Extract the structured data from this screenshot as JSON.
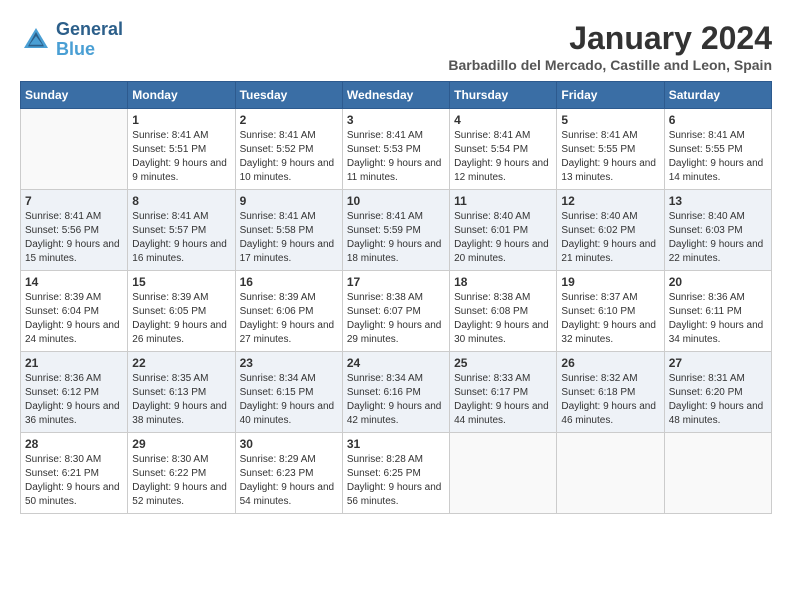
{
  "logo": {
    "text_general": "General",
    "text_blue": "Blue"
  },
  "title": "January 2024",
  "location": "Barbadillo del Mercado, Castille and Leon, Spain",
  "days_of_week": [
    "Sunday",
    "Monday",
    "Tuesday",
    "Wednesday",
    "Thursday",
    "Friday",
    "Saturday"
  ],
  "weeks": [
    [
      {
        "day": "",
        "sunrise": "",
        "sunset": "",
        "daylight": ""
      },
      {
        "day": "1",
        "sunrise": "Sunrise: 8:41 AM",
        "sunset": "Sunset: 5:51 PM",
        "daylight": "Daylight: 9 hours and 9 minutes."
      },
      {
        "day": "2",
        "sunrise": "Sunrise: 8:41 AM",
        "sunset": "Sunset: 5:52 PM",
        "daylight": "Daylight: 9 hours and 10 minutes."
      },
      {
        "day": "3",
        "sunrise": "Sunrise: 8:41 AM",
        "sunset": "Sunset: 5:53 PM",
        "daylight": "Daylight: 9 hours and 11 minutes."
      },
      {
        "day": "4",
        "sunrise": "Sunrise: 8:41 AM",
        "sunset": "Sunset: 5:54 PM",
        "daylight": "Daylight: 9 hours and 12 minutes."
      },
      {
        "day": "5",
        "sunrise": "Sunrise: 8:41 AM",
        "sunset": "Sunset: 5:55 PM",
        "daylight": "Daylight: 9 hours and 13 minutes."
      },
      {
        "day": "6",
        "sunrise": "Sunrise: 8:41 AM",
        "sunset": "Sunset: 5:55 PM",
        "daylight": "Daylight: 9 hours and 14 minutes."
      }
    ],
    [
      {
        "day": "7",
        "sunrise": "Sunrise: 8:41 AM",
        "sunset": "Sunset: 5:56 PM",
        "daylight": "Daylight: 9 hours and 15 minutes."
      },
      {
        "day": "8",
        "sunrise": "Sunrise: 8:41 AM",
        "sunset": "Sunset: 5:57 PM",
        "daylight": "Daylight: 9 hours and 16 minutes."
      },
      {
        "day": "9",
        "sunrise": "Sunrise: 8:41 AM",
        "sunset": "Sunset: 5:58 PM",
        "daylight": "Daylight: 9 hours and 17 minutes."
      },
      {
        "day": "10",
        "sunrise": "Sunrise: 8:41 AM",
        "sunset": "Sunset: 5:59 PM",
        "daylight": "Daylight: 9 hours and 18 minutes."
      },
      {
        "day": "11",
        "sunrise": "Sunrise: 8:40 AM",
        "sunset": "Sunset: 6:01 PM",
        "daylight": "Daylight: 9 hours and 20 minutes."
      },
      {
        "day": "12",
        "sunrise": "Sunrise: 8:40 AM",
        "sunset": "Sunset: 6:02 PM",
        "daylight": "Daylight: 9 hours and 21 minutes."
      },
      {
        "day": "13",
        "sunrise": "Sunrise: 8:40 AM",
        "sunset": "Sunset: 6:03 PM",
        "daylight": "Daylight: 9 hours and 22 minutes."
      }
    ],
    [
      {
        "day": "14",
        "sunrise": "Sunrise: 8:39 AM",
        "sunset": "Sunset: 6:04 PM",
        "daylight": "Daylight: 9 hours and 24 minutes."
      },
      {
        "day": "15",
        "sunrise": "Sunrise: 8:39 AM",
        "sunset": "Sunset: 6:05 PM",
        "daylight": "Daylight: 9 hours and 26 minutes."
      },
      {
        "day": "16",
        "sunrise": "Sunrise: 8:39 AM",
        "sunset": "Sunset: 6:06 PM",
        "daylight": "Daylight: 9 hours and 27 minutes."
      },
      {
        "day": "17",
        "sunrise": "Sunrise: 8:38 AM",
        "sunset": "Sunset: 6:07 PM",
        "daylight": "Daylight: 9 hours and 29 minutes."
      },
      {
        "day": "18",
        "sunrise": "Sunrise: 8:38 AM",
        "sunset": "Sunset: 6:08 PM",
        "daylight": "Daylight: 9 hours and 30 minutes."
      },
      {
        "day": "19",
        "sunrise": "Sunrise: 8:37 AM",
        "sunset": "Sunset: 6:10 PM",
        "daylight": "Daylight: 9 hours and 32 minutes."
      },
      {
        "day": "20",
        "sunrise": "Sunrise: 8:36 AM",
        "sunset": "Sunset: 6:11 PM",
        "daylight": "Daylight: 9 hours and 34 minutes."
      }
    ],
    [
      {
        "day": "21",
        "sunrise": "Sunrise: 8:36 AM",
        "sunset": "Sunset: 6:12 PM",
        "daylight": "Daylight: 9 hours and 36 minutes."
      },
      {
        "day": "22",
        "sunrise": "Sunrise: 8:35 AM",
        "sunset": "Sunset: 6:13 PM",
        "daylight": "Daylight: 9 hours and 38 minutes."
      },
      {
        "day": "23",
        "sunrise": "Sunrise: 8:34 AM",
        "sunset": "Sunset: 6:15 PM",
        "daylight": "Daylight: 9 hours and 40 minutes."
      },
      {
        "day": "24",
        "sunrise": "Sunrise: 8:34 AM",
        "sunset": "Sunset: 6:16 PM",
        "daylight": "Daylight: 9 hours and 42 minutes."
      },
      {
        "day": "25",
        "sunrise": "Sunrise: 8:33 AM",
        "sunset": "Sunset: 6:17 PM",
        "daylight": "Daylight: 9 hours and 44 minutes."
      },
      {
        "day": "26",
        "sunrise": "Sunrise: 8:32 AM",
        "sunset": "Sunset: 6:18 PM",
        "daylight": "Daylight: 9 hours and 46 minutes."
      },
      {
        "day": "27",
        "sunrise": "Sunrise: 8:31 AM",
        "sunset": "Sunset: 6:20 PM",
        "daylight": "Daylight: 9 hours and 48 minutes."
      }
    ],
    [
      {
        "day": "28",
        "sunrise": "Sunrise: 8:30 AM",
        "sunset": "Sunset: 6:21 PM",
        "daylight": "Daylight: 9 hours and 50 minutes."
      },
      {
        "day": "29",
        "sunrise": "Sunrise: 8:30 AM",
        "sunset": "Sunset: 6:22 PM",
        "daylight": "Daylight: 9 hours and 52 minutes."
      },
      {
        "day": "30",
        "sunrise": "Sunrise: 8:29 AM",
        "sunset": "Sunset: 6:23 PM",
        "daylight": "Daylight: 9 hours and 54 minutes."
      },
      {
        "day": "31",
        "sunrise": "Sunrise: 8:28 AM",
        "sunset": "Sunset: 6:25 PM",
        "daylight": "Daylight: 9 hours and 56 minutes."
      },
      {
        "day": "",
        "sunrise": "",
        "sunset": "",
        "daylight": ""
      },
      {
        "day": "",
        "sunrise": "",
        "sunset": "",
        "daylight": ""
      },
      {
        "day": "",
        "sunrise": "",
        "sunset": "",
        "daylight": ""
      }
    ]
  ]
}
